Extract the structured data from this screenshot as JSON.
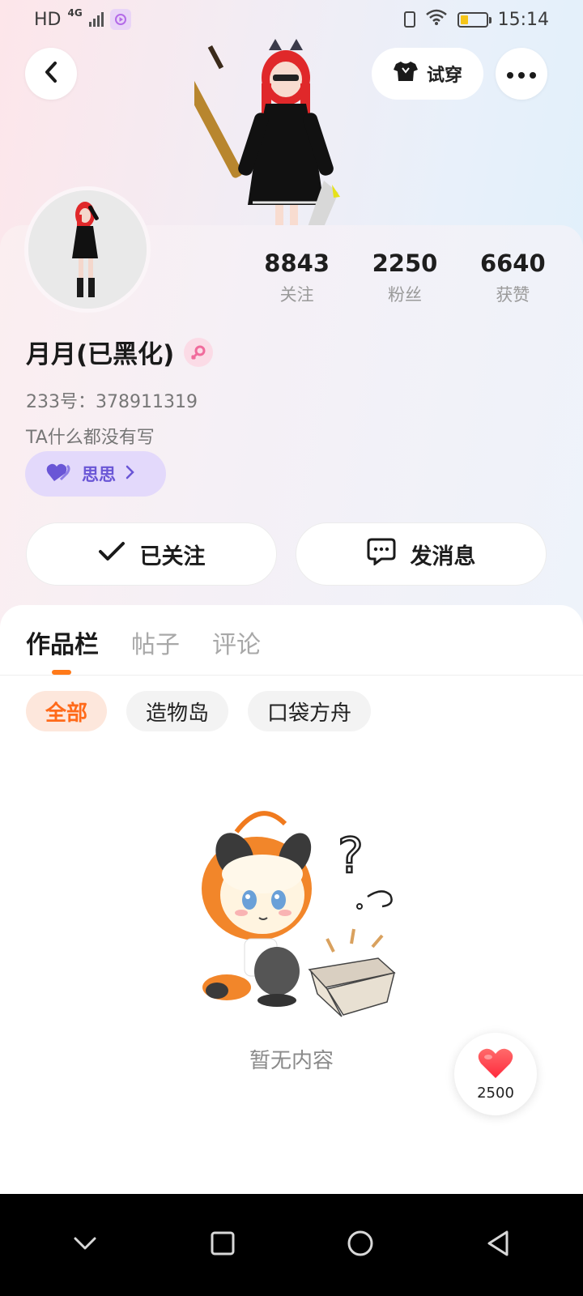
{
  "status_bar": {
    "hd": "HD",
    "network": "4G",
    "time": "15:14",
    "battery_color": "#f5c518"
  },
  "header": {
    "back_icon": "chevron-left-icon",
    "tryon_label": "试穿",
    "tryon_icon": "tshirt-icon",
    "more_icon": "more-dots-icon"
  },
  "stats": [
    {
      "value": "8843",
      "label": "关注"
    },
    {
      "value": "2250",
      "label": "粉丝"
    },
    {
      "value": "6640",
      "label": "获赞"
    }
  ],
  "profile": {
    "username": "月月(已黑化)",
    "gender_icon": "female-icon",
    "user_id": "233号：378911319",
    "bio": "TA什么都没有写",
    "relation_label": "思思",
    "relation_color": "#6a56d6"
  },
  "actions": {
    "follow_label": "已关注",
    "message_label": "发消息"
  },
  "tabs": [
    {
      "label": "作品栏",
      "active": true
    },
    {
      "label": "帖子",
      "active": false
    },
    {
      "label": "评论",
      "active": false
    }
  ],
  "filters": [
    {
      "label": "全部",
      "active": true
    },
    {
      "label": "造物岛",
      "active": false
    },
    {
      "label": "口袋方舟",
      "active": false
    }
  ],
  "empty_state": {
    "text": "暂无内容"
  },
  "like_fab": {
    "count": "2500",
    "accent": "#ff3b4a"
  }
}
